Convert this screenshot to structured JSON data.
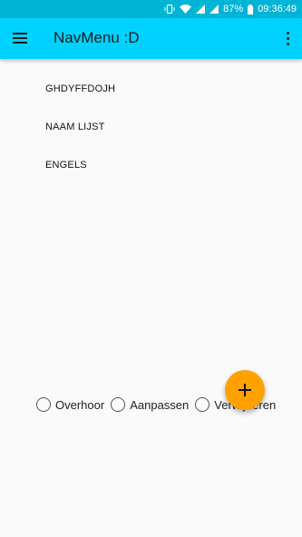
{
  "status_bar": {
    "battery_percent": "87%",
    "time": "09:36:49",
    "icons": [
      "vibrate-icon",
      "wifi-icon",
      "signal-icon",
      "signal-icon",
      "battery-icon"
    ]
  },
  "app_bar": {
    "title": "NavMenu :D",
    "menu_icon": "hamburger-menu-icon",
    "overflow_icon": "more-vert-icon"
  },
  "list": {
    "items": [
      {
        "label": "GHDYFFDOJH"
      },
      {
        "label": "NAAM LIJST"
      },
      {
        "label": "ENGELS"
      }
    ]
  },
  "radio_group": {
    "options": [
      {
        "label": "Overhoor",
        "selected": false
      },
      {
        "label": "Aanpassen",
        "selected": false
      },
      {
        "label": "Verwijderen",
        "selected": false
      }
    ]
  },
  "fab": {
    "icon": "plus-icon"
  },
  "colors": {
    "status_bar": "#00b4d6",
    "app_bar": "#00d2ff",
    "fab": "#ffa200",
    "background": "#fafafa"
  }
}
